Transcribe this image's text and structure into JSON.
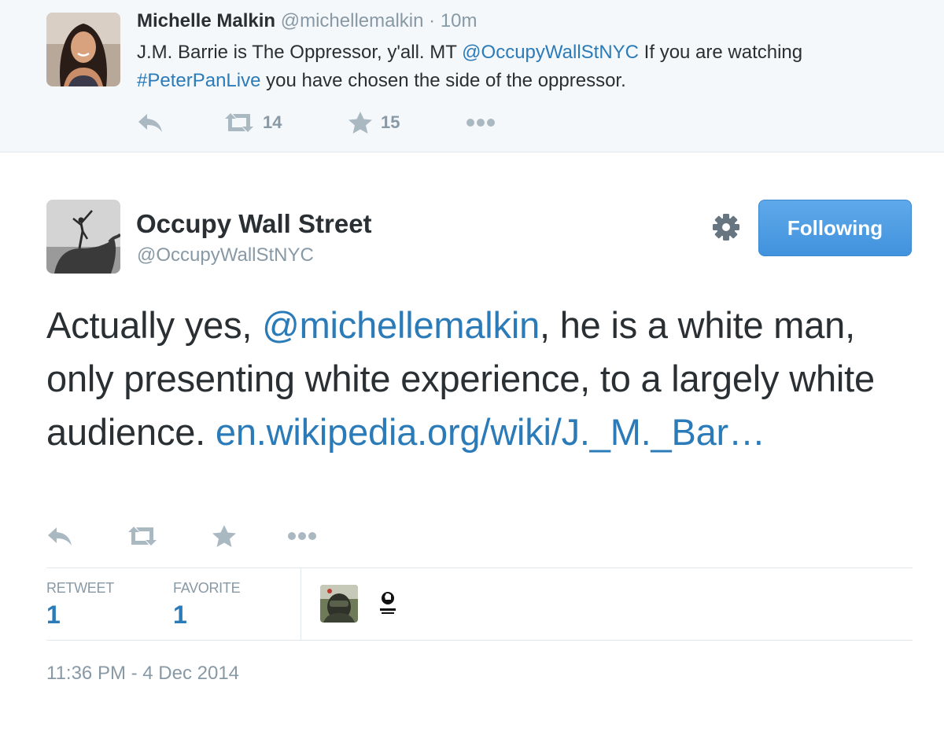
{
  "parent_tweet": {
    "author_name": "Michelle Malkin",
    "author_handle": "@michellemalkin",
    "separator": "·",
    "time": "10m",
    "text_parts": {
      "t1": "J.M. Barrie is The Oppressor, y'all. MT ",
      "mention": "@OccupyWallStNYC",
      "t2": " If you are watching ",
      "hashtag": "#PeterPanLive",
      "t3": " you have chosen the side of the oppressor."
    },
    "actions": {
      "reply_icon": "reply-icon",
      "retweet_icon": "retweet-icon",
      "retweet_count": "14",
      "favorite_icon": "star-icon",
      "favorite_count": "15",
      "more_icon": "more-dots-icon"
    }
  },
  "main_tweet": {
    "author_name": "Occupy Wall Street",
    "author_handle": "@OccupyWallStNYC",
    "follow_button_label": "Following",
    "settings_icon": "gear-icon",
    "text_parts": {
      "t1": "Actually yes, ",
      "mention": "@michellemalkin",
      "t2": ", he is a white man, only presenting white experience, to a largely white audience. ",
      "link": "en.wikipedia.org/wiki/J._M._Bar…"
    },
    "actions": [
      "reply-icon",
      "retweet-icon",
      "star-icon",
      "more-dots-icon"
    ],
    "stats": {
      "retweet_label": "RETWEET",
      "retweet_count": "1",
      "favorite_label": "FAVORITE",
      "favorite_count": "1"
    },
    "timestamp": "11:36 PM - 4 Dec 2014"
  },
  "colors": {
    "link": "#2b7bb9",
    "muted": "#8899a6",
    "text": "#292f33",
    "follow_button": "#4a9ee3",
    "context_background": "#f5f8fa"
  }
}
